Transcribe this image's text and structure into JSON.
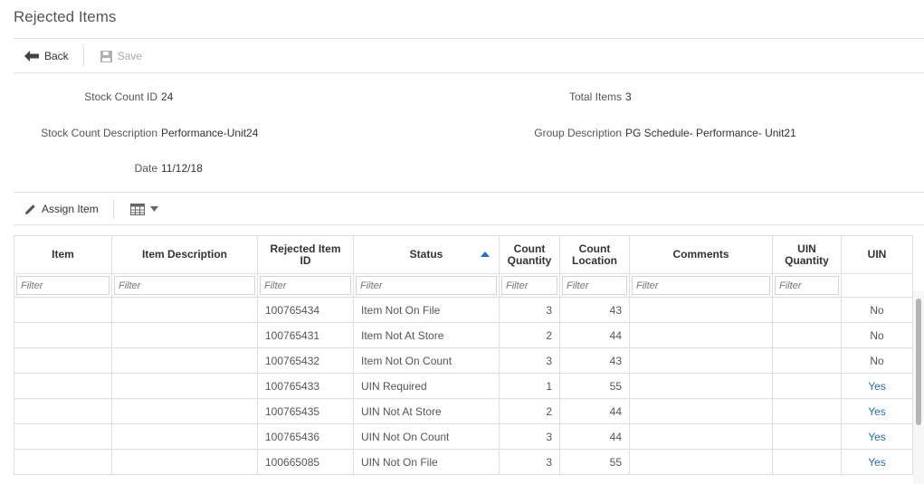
{
  "page": {
    "title": "Rejected Items"
  },
  "toolbar": {
    "back_label": "Back",
    "save_label": "Save"
  },
  "details": {
    "stock_count_id": {
      "label": "Stock Count ID",
      "value": "24"
    },
    "total_items": {
      "label": "Total Items",
      "value": "3"
    },
    "stock_count_description": {
      "label": "Stock Count Description",
      "value": "Performance-Unit24"
    },
    "group_description": {
      "label": "Group Description",
      "value": "PG Schedule- Performance- Unit21"
    },
    "date": {
      "label": "Date",
      "value": "11/12/18"
    }
  },
  "actions": {
    "assign_item_label": "Assign Item"
  },
  "table": {
    "columns": {
      "item": "Item",
      "item_description": "Item Description",
      "rejected_item_id": "Rejected Item ID",
      "status": "Status",
      "count_quantity": "Count Quantity",
      "count_location": "Count Location",
      "comments": "Comments",
      "uin_quantity": "UIN Quantity",
      "uin": "UIN"
    },
    "filter_placeholder": "Filter",
    "sorted_column": "status",
    "sort_direction": "ascending",
    "rows": [
      {
        "rejected_item_id": "100765434",
        "status": "Item Not On File",
        "count_quantity": "3",
        "count_location": "43",
        "uin": "No"
      },
      {
        "rejected_item_id": "100765431",
        "status": "Item Not At Store",
        "count_quantity": "2",
        "count_location": "44",
        "uin": "No"
      },
      {
        "rejected_item_id": "100765432",
        "status": "Item Not On Count",
        "count_quantity": "3",
        "count_location": "43",
        "uin": "No"
      },
      {
        "rejected_item_id": "100765433",
        "status": "UIN Required",
        "count_quantity": "1",
        "count_location": "55",
        "uin": "Yes"
      },
      {
        "rejected_item_id": "100765435",
        "status": "UIN Not At Store",
        "count_quantity": "2",
        "count_location": "44",
        "uin": "Yes"
      },
      {
        "rejected_item_id": "100765436",
        "status": "UIN Not On Count",
        "count_quantity": "3",
        "count_location": "44",
        "uin": "Yes"
      },
      {
        "rejected_item_id": "100665085",
        "status": "UIN Not On File",
        "count_quantity": "3",
        "count_location": "55",
        "uin": "Yes"
      }
    ]
  },
  "colors": {
    "link_blue": "#2a6fb3",
    "border": "#dedede"
  },
  "icons": {
    "back": "arrow-left-icon",
    "save": "floppy-disk-icon",
    "assign": "pencil-icon",
    "columns": "table-grid-icon"
  }
}
